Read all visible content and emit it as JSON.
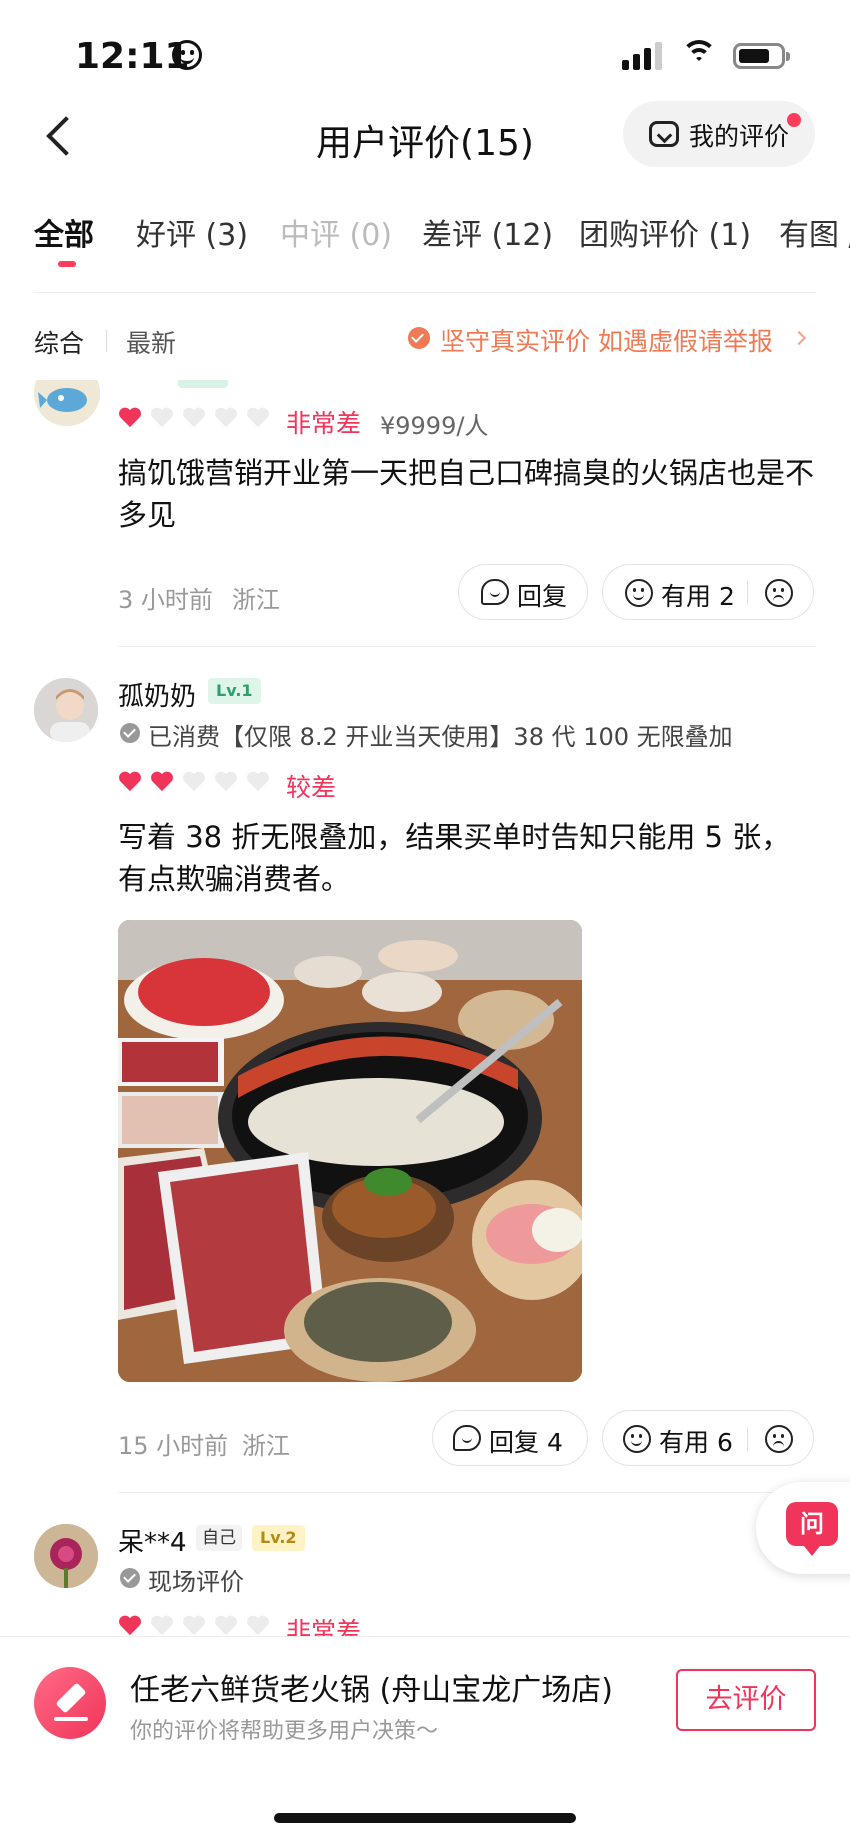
{
  "status_bar": {
    "time": "12:11"
  },
  "header": {
    "title": "用户评价(15)",
    "my_review": "我的评价"
  },
  "tabs": [
    "全部",
    "好评 (3)",
    "中评 (0)",
    "差评 (12)",
    "团购评价 (1)",
    "有图 /"
  ],
  "sort": {
    "comprehensive": "综合",
    "latest": "最新",
    "authentic": "坚守真实评价 如遇虚假请举报"
  },
  "reviews": [
    {
      "rating_text": "非常差",
      "hearts": 1,
      "price": "¥9999/人",
      "content": "搞饥饿营销开业第一天把自己口碑搞臭的火锅店也是不多见",
      "time": "3 小时前",
      "location": "浙江",
      "reply_label": "回复",
      "useful_label": "有用 2"
    },
    {
      "username": "孤奶奶",
      "level": "Lv.1",
      "consumed": "已消费【仅限 8.2 开业当天使用】38 代 100 无限叠加",
      "rating_text": "较差",
      "hearts": 2,
      "content": "写着 38 折无限叠加，结果买单时告知只能用 5 张，有点欺骗消费者。",
      "time": "15 小时前",
      "location": "浙江",
      "reply_label": "回复 4",
      "useful_label": "有用 6"
    },
    {
      "username": "呆**4",
      "self_tag": "自己",
      "level": "Lv.2",
      "onsite": "现场评价",
      "rating_text": "非常差",
      "hearts": 1
    }
  ],
  "ask": {
    "label": "问"
  },
  "bottom": {
    "store_name": "任老六鲜货老火锅 (舟山宝龙广场店)",
    "hint": "你的评价将帮助更多用户决策～",
    "button": "去评价"
  },
  "colors": {
    "accent": "#f0345a",
    "orange": "#f07a55"
  }
}
